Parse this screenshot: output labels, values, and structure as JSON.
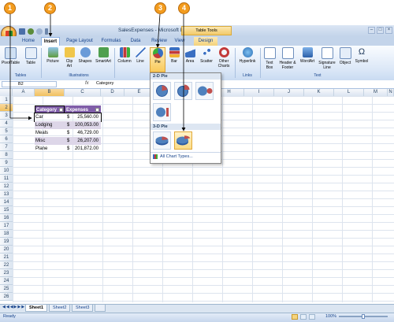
{
  "callouts": [
    "1",
    "2",
    "3",
    "4"
  ],
  "window": {
    "title": "SalesExpenses - Microsoft Excel",
    "contextual_tab_group": "Table Tools",
    "controls": [
      "–",
      "□",
      "×"
    ]
  },
  "tabs": [
    "Home",
    "Insert",
    "Page Layout",
    "Formulas",
    "Data",
    "Review",
    "View",
    "Design"
  ],
  "active_tab": "Insert",
  "ribbon": {
    "groups": {
      "tables": "Tables",
      "illustrations": "Illustrations",
      "links": "Links",
      "text": "Text"
    },
    "buttons": {
      "pivottable": "PivotTable",
      "table": "Table",
      "picture": "Picture",
      "clipart": "Clip Art",
      "shapes": "Shapes",
      "smartart": "SmartArt",
      "column": "Column",
      "line": "Line",
      "pie": "Pie",
      "bar": "Bar",
      "area": "Area",
      "scatter": "Scatter",
      "other": "Other Charts",
      "hyperlink": "Hyperlink",
      "textbox": "Text Box",
      "headerfooter": "Header & Footer",
      "wordart": "WordArt",
      "signature": "Signature Line",
      "object": "Object",
      "symbol": "Symbol"
    },
    "colors": {
      "accent": "#15428b",
      "ribbon_bg": "#dbe7f7"
    }
  },
  "formula_bar": {
    "name_box": "B2",
    "fx": "fx",
    "value": "Category"
  },
  "columns": [
    "A",
    "B",
    "C",
    "D",
    "E",
    "F",
    "G",
    "H",
    "I",
    "J",
    "K",
    "L",
    "M",
    "N"
  ],
  "selected_column": "B",
  "rows": [
    "1",
    "2",
    "3",
    "4",
    "5",
    "6",
    "7",
    "8",
    "9",
    "10",
    "11",
    "12",
    "13",
    "14",
    "15",
    "16",
    "17",
    "18",
    "19",
    "20",
    "21",
    "22",
    "23",
    "24",
    "25",
    "26"
  ],
  "selected_row": "2",
  "table": {
    "headers": [
      "Category",
      "Expenses"
    ],
    "header_color": "#7f5da8",
    "band_color": "#ddd6e8",
    "rows": [
      {
        "category": "Car",
        "currency": "$",
        "amount": "25,560.00"
      },
      {
        "category": "Lodging",
        "currency": "$",
        "amount": "100,053.00"
      },
      {
        "category": "Meals",
        "currency": "$",
        "amount": "46,729.00"
      },
      {
        "category": "Misc",
        "currency": "$",
        "amount": "26,207.00"
      },
      {
        "category": "Plane",
        "currency": "$",
        "amount": "201,872.00"
      }
    ]
  },
  "gallery": {
    "section_2d": "2-D Pie",
    "section_3d": "3-D Pie",
    "all_chart_types": "All Chart Types..."
  },
  "sheets": [
    "Sheet1",
    "Sheet2",
    "Sheet3"
  ],
  "active_sheet": "Sheet1",
  "status": {
    "text": "Ready",
    "zoom": "100%"
  }
}
